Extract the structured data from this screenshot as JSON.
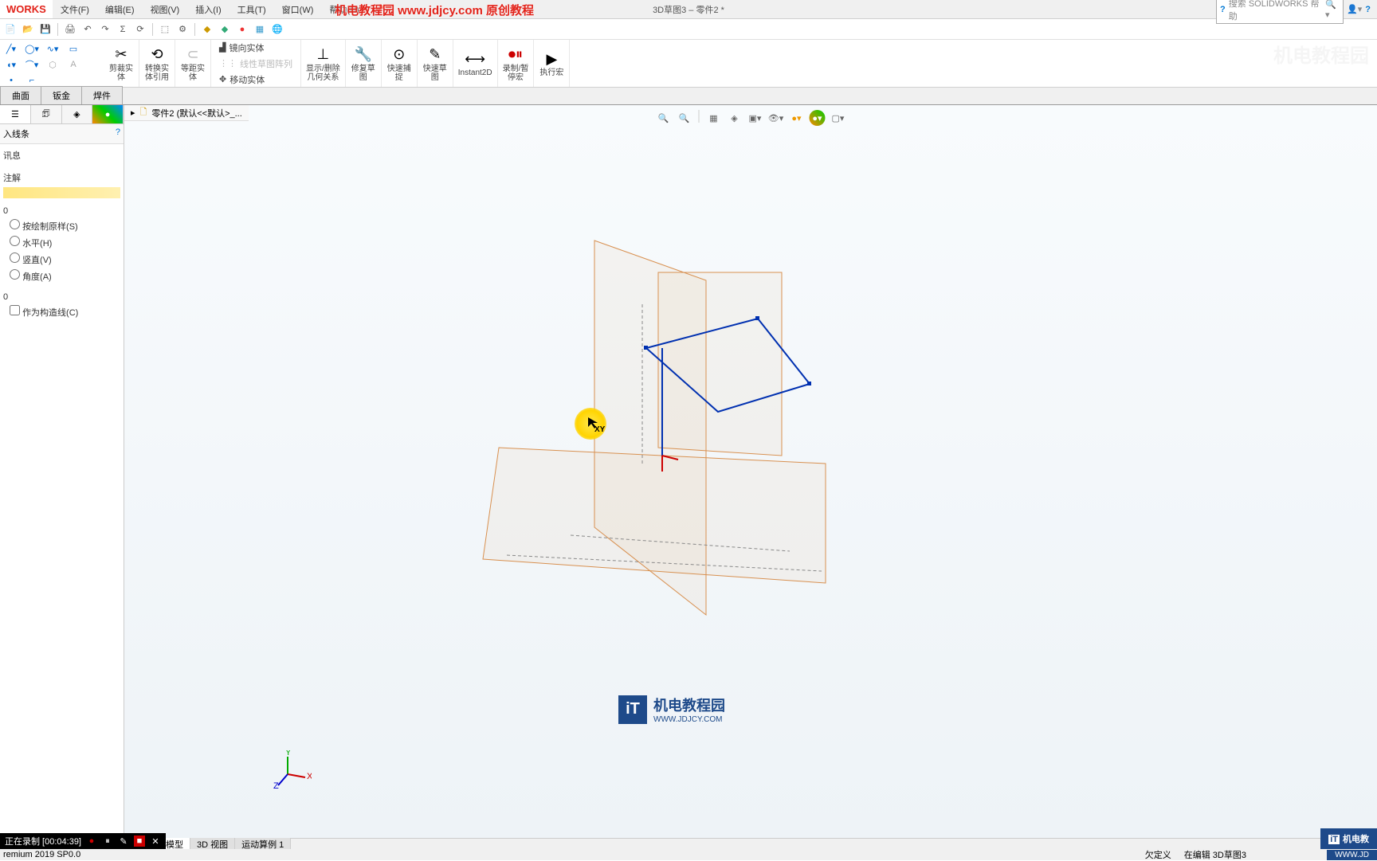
{
  "app": {
    "logo": "WORKS",
    "title": "3D草图3 – 零件2 *",
    "banner": "机电教程园 www.jdjcy.com 原创教程"
  },
  "menu": {
    "file": "文件(F)",
    "edit": "编辑(E)",
    "view": "视图(V)",
    "insert": "插入(I)",
    "tools": "工具(T)",
    "window": "窗口(W)",
    "help": "帮助(H)"
  },
  "search": {
    "placeholder": "搜索 SOLIDWORKS 帮助"
  },
  "ribbon": {
    "trim": "剪裁实\n体",
    "convert": "转换实\n体引用",
    "mirror": "镜向实体",
    "linear": "线性草图阵列",
    "move": "移动实体",
    "show_rel": "显示/删除\n几何关系",
    "repair": "修复草\n图",
    "quick_snap": "快速捕\n捉",
    "rapid": "快速草\n图",
    "instant": "Instant2D",
    "record": "录制/暂\n停宏",
    "run": "执行宏"
  },
  "tabs": {
    "surface": "曲面",
    "sheetmetal": "钣金",
    "weldment": "焊件"
  },
  "panel": {
    "title": "入线条",
    "tip": "讯息",
    "section1": "注解",
    "section2": "按绘制原样(S)",
    "h": "水平(H)",
    "v": "竖直(V)",
    "a": "角度(A)",
    "construction": "作为构造线(C)"
  },
  "breadcrumb": {
    "part": "零件2 (默认<<默认>_..."
  },
  "cursor": {
    "label": "XY"
  },
  "status": {
    "tab1": "模型",
    "tab2": "3D 视图",
    "tab3": "运动算例 1",
    "version": "remium 2019 SP0.0",
    "right1": "欠定义",
    "right2": "在编辑  3D草图3"
  },
  "recording": {
    "text": "正在录制 [00:04:39]"
  },
  "watermark": {
    "tr": "机电教程园",
    "center_name": "机电教程园",
    "center_url": "WWW.JDJCY.COM",
    "br": "机电教",
    "br_url": "WWW.JD"
  }
}
